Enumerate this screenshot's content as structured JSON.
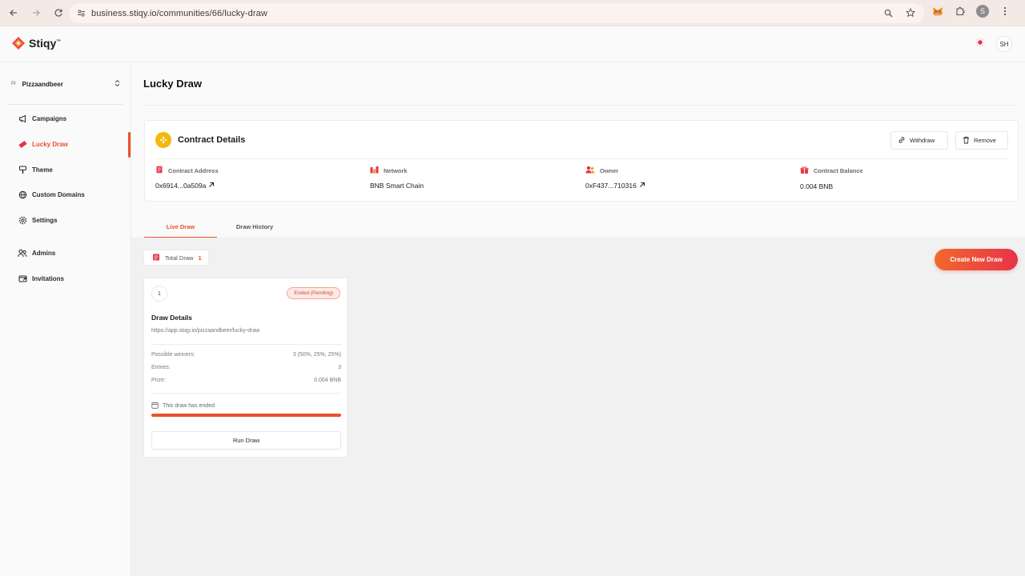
{
  "browser": {
    "url": "business.stiqy.io/communities/66/lucky-draw",
    "profile_initial": "S"
  },
  "header": {
    "logo_text": "Stiqy",
    "logo_tm": "™",
    "user_initials": "SH"
  },
  "sidebar": {
    "community_badge": "PI",
    "community_name": "Pizzaandbeer",
    "items": [
      {
        "label": "Campaigns",
        "icon": "megaphone-icon"
      },
      {
        "label": "Lucky Draw",
        "icon": "ticket-icon"
      },
      {
        "label": "Theme",
        "icon": "brush-icon"
      },
      {
        "label": "Custom Domains",
        "icon": "globe-icon"
      },
      {
        "label": "Settings",
        "icon": "gear-icon"
      },
      {
        "label": "Admins",
        "icon": "users-icon"
      },
      {
        "label": "Invitations",
        "icon": "invite-icon"
      }
    ],
    "active_index": 1
  },
  "main": {
    "title": "Lucky Draw",
    "contract": {
      "title": "Contract Details",
      "withdraw_label": "Withdraw",
      "remove_label": "Remove",
      "fields": [
        {
          "label": "Contract Address",
          "value": "0x6914...0a509a",
          "link": true
        },
        {
          "label": "Network",
          "value": "BNB Smart Chain",
          "link": false
        },
        {
          "label": "Owner",
          "value": "0xF437...710316",
          "link": true
        },
        {
          "label": "Contract Balance",
          "value": "0.004 BNB",
          "link": false
        }
      ]
    },
    "tabs": [
      {
        "label": "Live Draw",
        "active": true
      },
      {
        "label": "Draw History",
        "active": false
      }
    ],
    "total_draw_label": "Total Draw",
    "total_draw_count": "1",
    "create_label": "Create New Draw",
    "draw": {
      "number": "1",
      "status": "Ended (Pending)",
      "title": "Draw Details",
      "link": "https://app.stiqy.io/pizzaandbeer/lucky-draw",
      "rows": [
        {
          "label": "Possible winners:",
          "value": "3 (50%, 25%, 25%)"
        },
        {
          "label": "Entries:",
          "value": "3"
        },
        {
          "label": "Prize:",
          "value": "0.004 BNB"
        }
      ],
      "ended_text": "This draw has ended",
      "progress": 1.0,
      "run_label": "Run Draw"
    }
  },
  "colors": {
    "accent": "#e8512b",
    "bnb": "#f0b90b"
  }
}
